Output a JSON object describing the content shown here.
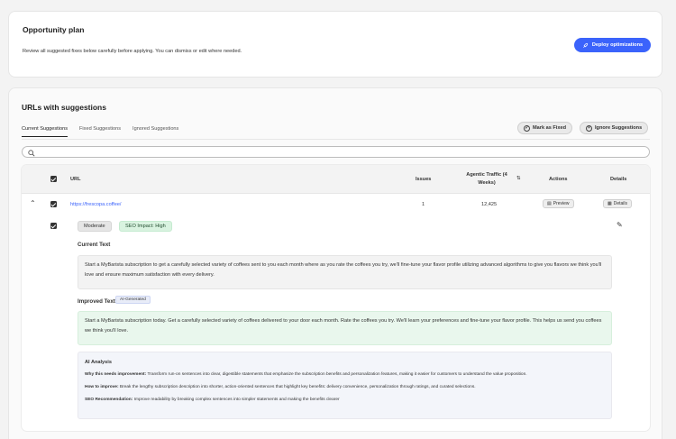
{
  "opportunity": {
    "title": "Opportunity plan",
    "description": "Review all suggested fixes below carefully before applying. You can dismiss or edit where needed.",
    "deploy_label": "Deploy optimizations"
  },
  "urls_section": {
    "title": "URLs with suggestions",
    "tabs": [
      {
        "label": "Current Suggestions",
        "active": true
      },
      {
        "label": "Fixed Suggestions",
        "active": false
      },
      {
        "label": "Ignored Suggestions",
        "active": false
      }
    ],
    "mark_fixed_label": "Mark as Fixed",
    "ignore_label": "Ignore Suggestions",
    "search_placeholder": ""
  },
  "table": {
    "headers": {
      "url": "URL",
      "issues": "Issues",
      "traffic": "Agentic Traffic (4 Weeks)",
      "actions": "Actions",
      "details": "Details"
    },
    "row": {
      "url": "https://frescopa.coffee/",
      "issues": "1",
      "traffic": "12,425",
      "preview_label": "Preview",
      "details_label": "Details"
    }
  },
  "suggestion": {
    "severity": "Moderate",
    "seo_impact": "SEO Impact: High",
    "current_text_title": "Current Text",
    "current_text": "Start a MyBarista subscription to get a carefully selected variety of coffees sent to you each month where as you rate the coffees you try, we'll fine-tune your flavor profile utilizing advanced algorithms to give you flavors we think you'll love and ensure maximum satisfaction with every delivery.",
    "improved_text_title": "Improved Text",
    "ai_tag": "AI-Generated",
    "improved_text": "Start a MyBarista subscription today. Get a carefully selected variety of coffees delivered to your door each month. Rate the coffees you try. We'll learn your preferences and fine-tune your flavor profile. This helps us send you coffees we think you'll love.",
    "analysis": {
      "title": "AI Analysis",
      "why_label": "Why this needs improvement:",
      "why": "Transform run-on sentences into clear, digestible statements that emphasize the subscription benefits and personalization features, making it easier for customers to understand the value proposition.",
      "how_label": "How to improve:",
      "how": "Break the lengthy subscription description into shorter, action-oriented sentences that highlight key benefits: delivery convenience, personalization through ratings, and curated selections.",
      "seo_label": "SEO Recommendation:",
      "seo": "Improve readability by breaking complex sentences into simpler statements and making the benefits clearer"
    }
  },
  "colors": {
    "accent": "#3b63fb",
    "improved_bg": "#e9f7ed",
    "analysis_bg": "#f3f5fa"
  }
}
